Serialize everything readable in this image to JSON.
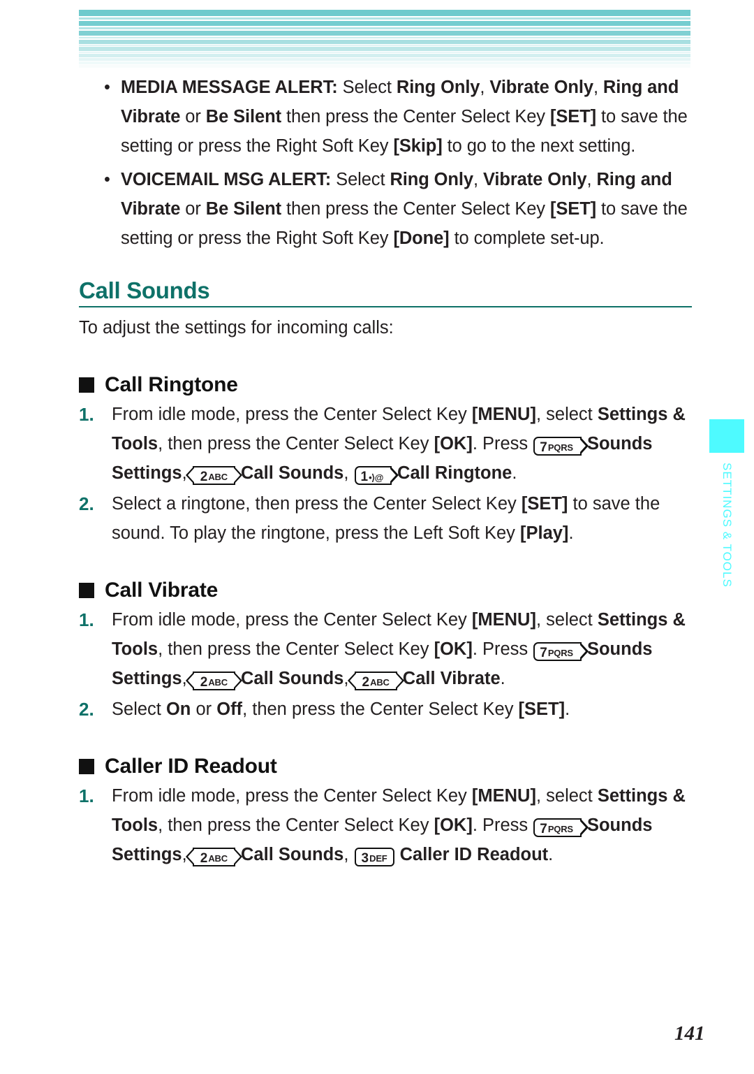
{
  "header": {
    "decoration": "striped-band",
    "accent_color": "#7acfd3"
  },
  "alerts": [
    {
      "bullet": "•",
      "name": "media-message-alert",
      "segments": [
        {
          "text": "MEDIA MESSAGE ALERT:",
          "bold": true
        },
        {
          "text": " Select ",
          "bold": false
        },
        {
          "text": "Ring Only",
          "bold": true
        },
        {
          "text": ", ",
          "bold": false
        },
        {
          "text": "Vibrate Only",
          "bold": true
        },
        {
          "text": ", ",
          "bold": false
        },
        {
          "text": "Ring and Vibrate",
          "bold": true
        },
        {
          "text": " or ",
          "bold": false
        },
        {
          "text": "Be Silent",
          "bold": true
        },
        {
          "text": " then press the Center Select Key ",
          "bold": false
        },
        {
          "text": "[SET]",
          "bold": true
        },
        {
          "text": " to save the setting or press the Right Soft Key ",
          "bold": false
        },
        {
          "text": "[Skip]",
          "bold": true
        },
        {
          "text": " to go to the next setting.",
          "bold": false
        }
      ]
    },
    {
      "bullet": "•",
      "name": "voicemail-msg-alert",
      "segments": [
        {
          "text": "VOICEMAIL MSG ALERT:",
          "bold": true
        },
        {
          "text": " Select ",
          "bold": false
        },
        {
          "text": "Ring Only",
          "bold": true
        },
        {
          "text": ", ",
          "bold": false
        },
        {
          "text": "Vibrate Only",
          "bold": true
        },
        {
          "text": ", ",
          "bold": false
        },
        {
          "text": "Ring and Vibrate",
          "bold": true
        },
        {
          "text": " or ",
          "bold": false
        },
        {
          "text": "Be Silent",
          "bold": true
        },
        {
          "text": " then press the Center Select Key ",
          "bold": false
        },
        {
          "text": "[SET]",
          "bold": true
        },
        {
          "text": " to save the setting or press the Right Soft Key ",
          "bold": false
        },
        {
          "text": "[Done]",
          "bold": true
        },
        {
          "text": " to complete set-up.",
          "bold": false
        }
      ]
    }
  ],
  "section": {
    "title": "Call Sounds",
    "title_color": "#0e7168",
    "intro": "To adjust the settings for incoming calls:"
  },
  "subsections": [
    {
      "title": "Call Ringtone",
      "steps": [
        {
          "number": "1.",
          "segments": [
            {
              "text": "From idle mode, press the Center Select Key ",
              "bold": false
            },
            {
              "text": "[MENU]",
              "bold": true
            },
            {
              "text": ", select ",
              "bold": false
            },
            {
              "text": "Settings & Tools",
              "bold": true
            },
            {
              "text": ", then press the Center Select Key ",
              "bold": false
            },
            {
              "text": "[OK]",
              "bold": true
            },
            {
              "text": ". Press ",
              "bold": false
            },
            {
              "key": {
                "digit": "7",
                "label": "PQRS",
                "shape": "cap-right"
              }
            },
            {
              "text": " ",
              "bold": false
            },
            {
              "text": "Sounds Settings",
              "bold": true
            },
            {
              "text": ", ",
              "bold": false
            },
            {
              "key": {
                "digit": "2",
                "label": "ABC",
                "shape": "cap-both"
              }
            },
            {
              "text": " ",
              "bold": false
            },
            {
              "text": "Call Sounds",
              "bold": true
            },
            {
              "text": ", ",
              "bold": false
            },
            {
              "key": {
                "digit": "1",
                "label": "•⟩@",
                "shape": "cap-right",
                "icon": "voicemail-key"
              }
            },
            {
              "text": " ",
              "bold": false
            },
            {
              "text": "Call Ringtone",
              "bold": true
            },
            {
              "text": ".",
              "bold": false
            }
          ]
        },
        {
          "number": "2.",
          "segments": [
            {
              "text": "Select a ringtone, then press the Center Select Key ",
              "bold": false
            },
            {
              "text": "[SET]",
              "bold": true
            },
            {
              "text": " to save the sound. To play the ringtone, press the Left Soft Key ",
              "bold": false
            },
            {
              "text": "[Play]",
              "bold": true
            },
            {
              "text": ".",
              "bold": false
            }
          ]
        }
      ]
    },
    {
      "title": "Call Vibrate",
      "steps": [
        {
          "number": "1.",
          "segments": [
            {
              "text": "From idle mode, press the Center Select Key ",
              "bold": false
            },
            {
              "text": "[MENU]",
              "bold": true
            },
            {
              "text": ", select ",
              "bold": false
            },
            {
              "text": "Settings & Tools",
              "bold": true
            },
            {
              "text": ", then press the Center Select Key ",
              "bold": false
            },
            {
              "text": "[OK]",
              "bold": true
            },
            {
              "text": ". Press ",
              "bold": false
            },
            {
              "key": {
                "digit": "7",
                "label": "PQRS",
                "shape": "cap-right"
              }
            },
            {
              "text": " ",
              "bold": false
            },
            {
              "text": "Sounds Settings",
              "bold": true
            },
            {
              "text": ", ",
              "bold": false
            },
            {
              "key": {
                "digit": "2",
                "label": "ABC",
                "shape": "cap-both"
              }
            },
            {
              "text": " ",
              "bold": false
            },
            {
              "text": "Call Sounds",
              "bold": true
            },
            {
              "text": ", ",
              "bold": false
            },
            {
              "key": {
                "digit": "2",
                "label": "ABC",
                "shape": "cap-both"
              }
            },
            {
              "text": " ",
              "bold": false
            },
            {
              "text": "Call Vibrate",
              "bold": true
            },
            {
              "text": ".",
              "bold": false
            }
          ]
        },
        {
          "number": "2.",
          "segments": [
            {
              "text": "Select ",
              "bold": false
            },
            {
              "text": "On",
              "bold": true
            },
            {
              "text": " or ",
              "bold": false
            },
            {
              "text": "Off",
              "bold": true
            },
            {
              "text": ", then press the Center Select Key ",
              "bold": false
            },
            {
              "text": "[SET]",
              "bold": true
            },
            {
              "text": ".",
              "bold": false
            }
          ]
        }
      ]
    },
    {
      "title": "Caller ID Readout",
      "steps": [
        {
          "number": "1.",
          "segments": [
            {
              "text": "From idle mode, press the Center Select Key ",
              "bold": false
            },
            {
              "text": "[MENU]",
              "bold": true
            },
            {
              "text": ", select ",
              "bold": false
            },
            {
              "text": "Settings & Tools",
              "bold": true
            },
            {
              "text": ", then press the Center Select Key ",
              "bold": false
            },
            {
              "text": "[OK]",
              "bold": true
            },
            {
              "text": ". Press ",
              "bold": false
            },
            {
              "key": {
                "digit": "7",
                "label": "PQRS",
                "shape": "cap-right"
              }
            },
            {
              "text": " ",
              "bold": false
            },
            {
              "text": "Sounds Settings",
              "bold": true
            },
            {
              "text": ", ",
              "bold": false
            },
            {
              "key": {
                "digit": "2",
                "label": "ABC",
                "shape": "cap-both"
              }
            },
            {
              "text": " ",
              "bold": false
            },
            {
              "text": "Call Sounds",
              "bold": true
            },
            {
              "text": ", ",
              "bold": false
            },
            {
              "key": {
                "digit": "3",
                "label": "DEF",
                "shape": "cap-rrect"
              }
            },
            {
              "text": " ",
              "bold": false
            },
            {
              "text": "Caller ID Readout",
              "bold": true
            },
            {
              "text": ".",
              "bold": false
            }
          ]
        }
      ]
    }
  ],
  "side_tab": {
    "label": "SETTINGS & TOOLS",
    "color": "#4efaff"
  },
  "page_number": "141"
}
